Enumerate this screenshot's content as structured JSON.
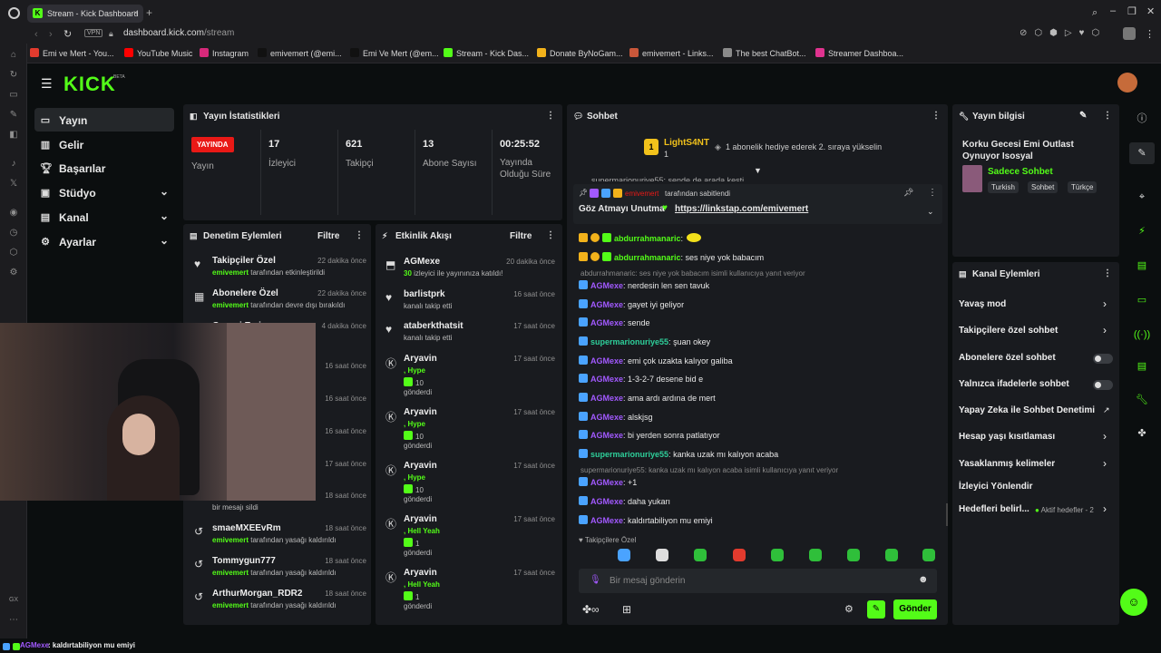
{
  "browser": {
    "tab_title": "Stream - Kick Dashboard",
    "url_host": "dashboard.kick.com",
    "url_path": "/stream",
    "vpn": "VPN",
    "bookmarks": [
      {
        "label": "Emi ve Mert - You...",
        "color": "#e23b2e"
      },
      {
        "label": "YouTube Music",
        "color": "#ff0000"
      },
      {
        "label": "Instagram",
        "color": "#d6297a"
      },
      {
        "label": "emivemert (@emi...",
        "color": "#111"
      },
      {
        "label": "Emi Ve Mert (@em...",
        "color": "#111"
      },
      {
        "label": "Stream - Kick Das...",
        "color": "#53fc18"
      },
      {
        "label": "Donate ByNoGam...",
        "color": "#f2b21b"
      },
      {
        "label": "emivemert - Links...",
        "color": "#c9573a"
      },
      {
        "label": "The best ChatBot...",
        "color": "#8a8a8a"
      },
      {
        "label": "Streamer Dashboa...",
        "color": "#e0338f"
      }
    ]
  },
  "kick": {
    "logo": "KICK",
    "beta": "BETA"
  },
  "nav": [
    {
      "label": "Yayın",
      "icon": "tv-icon"
    },
    {
      "label": "Gelir",
      "icon": "chart-icon"
    },
    {
      "label": "Başarılar",
      "icon": "trophy-icon"
    },
    {
      "label": "Stüdyo",
      "icon": "studio-icon"
    },
    {
      "label": "Kanal",
      "icon": "person-icon"
    },
    {
      "label": "Ayarlar",
      "icon": "gear-icon"
    }
  ],
  "stats": {
    "title": "Yayın İstatistikleri",
    "live_badge": "YAYINDA",
    "live_label": "Yayın",
    "viewers": "17",
    "viewers_label": "İzleyici",
    "followers": "621",
    "followers_label": "Takipçi",
    "subs": "13",
    "subs_label": "Abone Sayısı",
    "uptime": "00:25:52",
    "uptime_label": "Yayında Olduğu Süre"
  },
  "mod": {
    "title": "Denetim Eylemleri",
    "filter": "Filtre",
    "items": [
      {
        "title": "Takipçiler Özel",
        "user": "emivemert",
        "sub": " tarafından etkinleştirildi",
        "time": "22 dakika önce"
      },
      {
        "title": "Abonelere Özel",
        "user": "emivemert",
        "sub": " tarafından devre dışı bırakıldı",
        "time": "22 dakika önce"
      },
      {
        "title": "Gecesi Emi",
        "user": "",
        "sub": "k değiştirildi",
        "time": "4 dakika önce"
      },
      {
        "title": "",
        "user": "",
        "sub": "",
        "time": "16 saat önce"
      },
      {
        "title": "",
        "user": "",
        "sub": "ştirildi",
        "time": "16 saat önce"
      },
      {
        "title": "",
        "user": "",
        "sub": "ştirildi",
        "time": "16 saat önce"
      },
      {
        "title": "",
        "user": "",
        "sub": "",
        "time": "17 saat önce"
      },
      {
        "title": "",
        "user": "",
        "sub": "bir mesajı sildi",
        "time": "18 saat önce"
      },
      {
        "title": "smaeMXEEvRm",
        "user": "emivemert",
        "sub": " tarafından yasağı kaldırıldı",
        "time": "18 saat önce"
      },
      {
        "title": "Tommygun777",
        "user": "emivemert",
        "sub": " tarafından yasağı kaldırıldı",
        "time": "18 saat önce"
      },
      {
        "title": "ArthurMorgan_RDR2",
        "user": "emivemert",
        "sub": " tarafından yasağı kaldırıldı",
        "time": "18 saat önce"
      }
    ]
  },
  "activity": {
    "title": "Etkinlik Akışı",
    "filter": "Filtre",
    "items": [
      {
        "title": "AGMexe",
        "l1": "30",
        "l1b": " izleyici ile yayınınıza katıldı!",
        "l2": "",
        "l3": "",
        "time": "20 dakika önce",
        "icon": "raid-icon"
      },
      {
        "title": "barlistprk",
        "l1": "",
        "l1b": "kanalı takip etti",
        "l2": "",
        "l3": "",
        "time": "16 saat önce",
        "icon": "heart-icon"
      },
      {
        "title": "ataberkthatsit",
        "l1": "",
        "l1b": "kanalı takip etti",
        "l2": "",
        "l3": "",
        "time": "17 saat önce",
        "icon": "heart-icon"
      },
      {
        "title": "Aryavin",
        "l1": ", Hype",
        "l1b": "",
        "l2": "10",
        "l3": "gönderdi",
        "time": "17 saat önce",
        "icon": "kick-icon"
      },
      {
        "title": "Aryavin",
        "l1": ", Hype",
        "l1b": "",
        "l2": "10",
        "l3": "gönderdi",
        "time": "17 saat önce",
        "icon": "kick-icon"
      },
      {
        "title": "Aryavin",
        "l1": ", Hype",
        "l1b": "",
        "l2": "10",
        "l3": "gönderdi",
        "time": "17 saat önce",
        "icon": "kick-icon"
      },
      {
        "title": "Aryavin",
        "l1": ", Hell Yeah",
        "l1b": "",
        "l2": "1",
        "l3": "gönderdi",
        "time": "17 saat önce",
        "icon": "kick-icon"
      },
      {
        "title": "Aryavin",
        "l1": ", Hell Yeah",
        "l1b": "",
        "l2": "1",
        "l3": "gönderdi",
        "time": "17 saat önce",
        "icon": "kick-icon"
      }
    ]
  },
  "chat": {
    "title": "Sohbet",
    "top_user": "LightS4NT",
    "top_count": "1",
    "top_msg": "1 abonelik hediye ederek 2. sıraya yükselin",
    "pinned_by": "emivemert",
    "pinned_suffix": " tarafından sabitlendi",
    "pinned_text": "Göz Atmayı Unutma",
    "pinned_link": "https://linkstap.com/emivemert",
    "ghost": "supermarionuriye55: sende de arada kesti",
    "messages": [
      {
        "user": "abdurrahmanaric",
        "text": "",
        "color": "#53fc18",
        "reply": ""
      },
      {
        "user": "abdurrahmanaric",
        "text": " ses niye yok babacım",
        "color": "#53fc18",
        "reply": ""
      },
      {
        "user": "",
        "text": "",
        "color": "",
        "reply": "abdurrahmanaric: ses niye yok babacım isimli kullanıcıya yanıt veriyor"
      },
      {
        "user": "AGMexe",
        "text": " nerdesin len sen tavuk",
        "color": "#a259ff",
        "reply": ""
      },
      {
        "user": "AGMexe",
        "text": " gayet iyi geliyor",
        "color": "#a259ff",
        "reply": ""
      },
      {
        "user": "AGMexe",
        "text": " sende",
        "color": "#a259ff",
        "reply": ""
      },
      {
        "user": "supermarionuriye55",
        "text": " şuan okey",
        "color": "#2ecf9a",
        "reply": ""
      },
      {
        "user": "AGMexe",
        "text": " emi çok uzakta kalıyor galiba",
        "color": "#a259ff",
        "reply": ""
      },
      {
        "user": "AGMexe",
        "text": " 1-3-2-7 desene bid e",
        "color": "#a259ff",
        "reply": ""
      },
      {
        "user": "AGMexe",
        "text": " ama ardı ardına de mert",
        "color": "#a259ff",
        "reply": ""
      },
      {
        "user": "AGMexe",
        "text": " alskjsg",
        "color": "#a259ff",
        "reply": ""
      },
      {
        "user": "AGMexe",
        "text": " bi yerden sonra patlatıyor",
        "color": "#a259ff",
        "reply": ""
      },
      {
        "user": "supermarionuriye55",
        "text": " kanka uzak mı kalıyon acaba",
        "color": "#2ecf9a",
        "reply": ""
      },
      {
        "user": "",
        "text": "",
        "color": "",
        "reply": "supermarionuriye55: kanka uzak mı kalıyon acaba isimli kullanıcıya yanıt veriyor"
      },
      {
        "user": "AGMexe",
        "text": " +1",
        "color": "#a259ff",
        "reply": ""
      },
      {
        "user": "AGMexe",
        "text": " daha yukarı",
        "color": "#a259ff",
        "reply": ""
      },
      {
        "user": "AGMexe",
        "text": " kaldırtabiliyon mu emiyi",
        "color": "#a259ff",
        "reply": ""
      }
    ],
    "followers_only": "Takipçilere Özel",
    "input_placeholder": "Bir mesaj gönderin",
    "send": "Gönder"
  },
  "info": {
    "title": "Yayın bilgisi",
    "stream_title": "Korku Gecesi Emi Outlast Oynuyor Isosyal",
    "category": "Sadece Sohbet",
    "tags": [
      "Turkish",
      "Sohbet",
      "Türkçe"
    ]
  },
  "channel": {
    "title": "Kanal Eylemleri",
    "items": [
      {
        "label": "Yavaş mod",
        "ctrl": "chev"
      },
      {
        "label": "Takipçilere özel sohbet",
        "ctrl": "chev"
      },
      {
        "label": "Abonelere özel sohbet",
        "ctrl": "toggle"
      },
      {
        "label": "Yalnızca ifadelerle sohbet",
        "ctrl": "toggle"
      },
      {
        "label": "Yapay Zeka ile Sohbet Denetimi",
        "ctrl": "ext"
      },
      {
        "label": "Hesap yaşı kısıtlaması",
        "ctrl": "chev"
      },
      {
        "label": "Yasaklanmış kelimeler",
        "ctrl": "chev"
      },
      {
        "label": "İzleyici Yönlendir",
        "ctrl": "none"
      },
      {
        "label": "Hedefleri belirl...",
        "ctrl": "chev"
      }
    ],
    "goal_status": "Aktif hedefler - 2"
  },
  "ticker": {
    "user": "AGMexe",
    "text": ": kaldırtabiliyon mu emiyi"
  },
  "colors": {
    "kick_green": "#53fc18",
    "live_red": "#e91916",
    "bg": "#0b0e0f",
    "panel": "#191b1f"
  }
}
